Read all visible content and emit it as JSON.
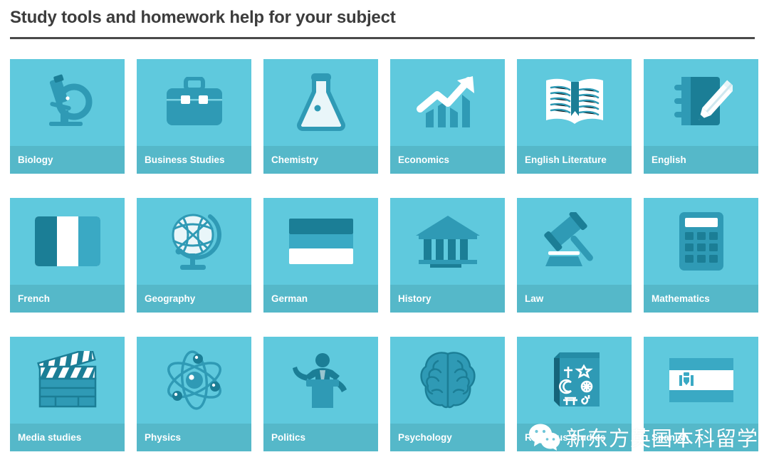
{
  "header": {
    "title": "Study tools and homework help for your subject"
  },
  "colors": {
    "tile_background": "#5fc9dd",
    "tile_label_band": "#55b8c9",
    "icon_dark": "#1b7e96",
    "icon_mid": "#2f9ab5",
    "icon_light": "#ffffff",
    "title_text": "#3c3c3c",
    "divider": "#4a4a4a",
    "label_text": "#ffffff"
  },
  "grid": {
    "columns": 6,
    "rows": 3,
    "tiles": [
      {
        "label": "Biology",
        "icon": "microscope-icon"
      },
      {
        "label": "Business Studies",
        "icon": "briefcase-icon"
      },
      {
        "label": "Chemistry",
        "icon": "flask-icon"
      },
      {
        "label": "Economics",
        "icon": "growth-chart-icon"
      },
      {
        "label": "English Literature",
        "icon": "open-book-icon"
      },
      {
        "label": "English",
        "icon": "notebook-pencil-icon"
      },
      {
        "label": "French",
        "icon": "french-flag-icon"
      },
      {
        "label": "Geography",
        "icon": "globe-icon"
      },
      {
        "label": "German",
        "icon": "german-flag-icon"
      },
      {
        "label": "History",
        "icon": "classical-building-icon"
      },
      {
        "label": "Law",
        "icon": "gavel-icon"
      },
      {
        "label": "Mathematics",
        "icon": "calculator-icon"
      },
      {
        "label": "Media studies",
        "icon": "clapperboard-icon"
      },
      {
        "label": "Physics",
        "icon": "atom-icon"
      },
      {
        "label": "Politics",
        "icon": "speaker-podium-icon"
      },
      {
        "label": "Psychology",
        "icon": "brain-icon"
      },
      {
        "label": "Religious Studies",
        "icon": "religious-book-icon"
      },
      {
        "label": "Spanish",
        "icon": "spanish-flag-icon"
      }
    ]
  },
  "watermark": {
    "text": "新东方英国本科留学",
    "icon": "wechat-icon"
  }
}
